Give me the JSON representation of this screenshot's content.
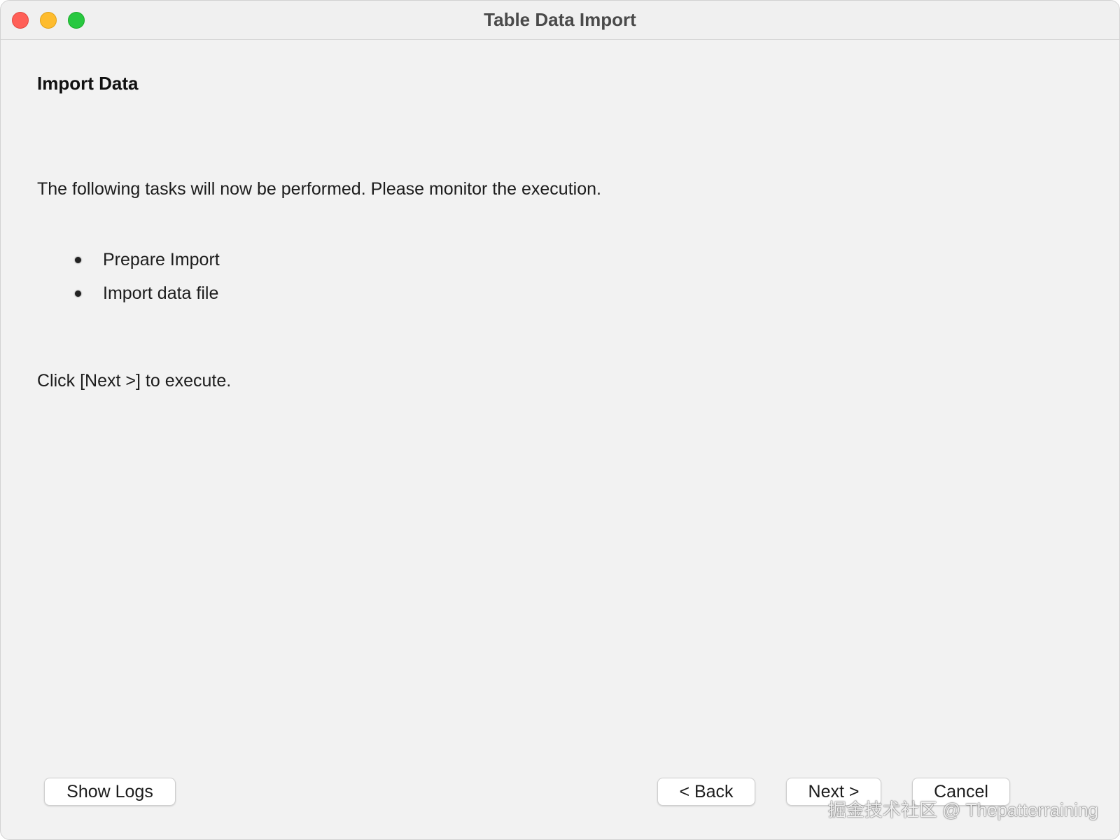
{
  "window": {
    "title": "Table Data Import"
  },
  "page": {
    "heading": "Import Data",
    "intro": "The following tasks will now be performed. Please monitor the execution.",
    "tasks": [
      {
        "label": "Prepare Import"
      },
      {
        "label": "Import data file"
      }
    ],
    "execute_hint": "Click [Next >] to execute."
  },
  "buttons": {
    "show_logs": "Show Logs",
    "back": "< Back",
    "next": "Next >",
    "cancel": "Cancel"
  },
  "watermark": "掘金技术社区 @ Thepatterraining",
  "colors": {
    "close": "#ff5f57",
    "minimize": "#febc2e",
    "maximize": "#28c840",
    "window_bg": "#f2f2f2"
  }
}
